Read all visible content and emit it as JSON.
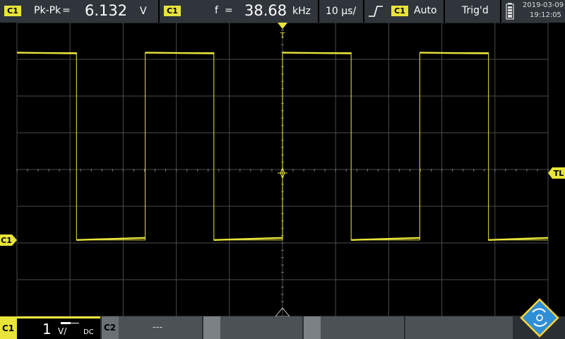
{
  "measurements": [
    {
      "channel": "C1",
      "name": "Pk-Pk",
      "eq": "=",
      "value": "6.132",
      "unit": "V"
    },
    {
      "channel": "C1",
      "name": "f",
      "eq": "=",
      "value": "38.68",
      "unit": "kHz"
    }
  ],
  "timebase": "10 µs/",
  "trigger": {
    "channel": "C1",
    "mode": "Auto",
    "state": "Trig'd"
  },
  "datetime": {
    "date": "2019-03-09",
    "time": "19:12:05"
  },
  "markers": {
    "trigger_top": "T",
    "trigger_level": "TL",
    "channel_ref": "C1"
  },
  "channels": [
    {
      "label": "C1",
      "scale_value": "1",
      "scale_unit": "V/",
      "coupling": "DC"
    },
    {
      "label": "C2",
      "scale_value": "---"
    }
  ],
  "colors": {
    "c1": "#e8e43b",
    "topbar": "#262b30",
    "grid": "#4a4a4a",
    "logo": "#2f8fd6"
  },
  "icons": {
    "battery": "battery-icon",
    "trigger_edge": "rising-edge-icon",
    "probe": "probe-icon",
    "logo": "rs-logo-icon"
  },
  "waveform": {
    "type": "square",
    "frequency_khz": 38.68,
    "peak_to_peak_v": 6.132,
    "volts_per_div": 1,
    "time_per_div_us": 10,
    "high_level_div": 3.2,
    "low_level_div": -1.9
  }
}
